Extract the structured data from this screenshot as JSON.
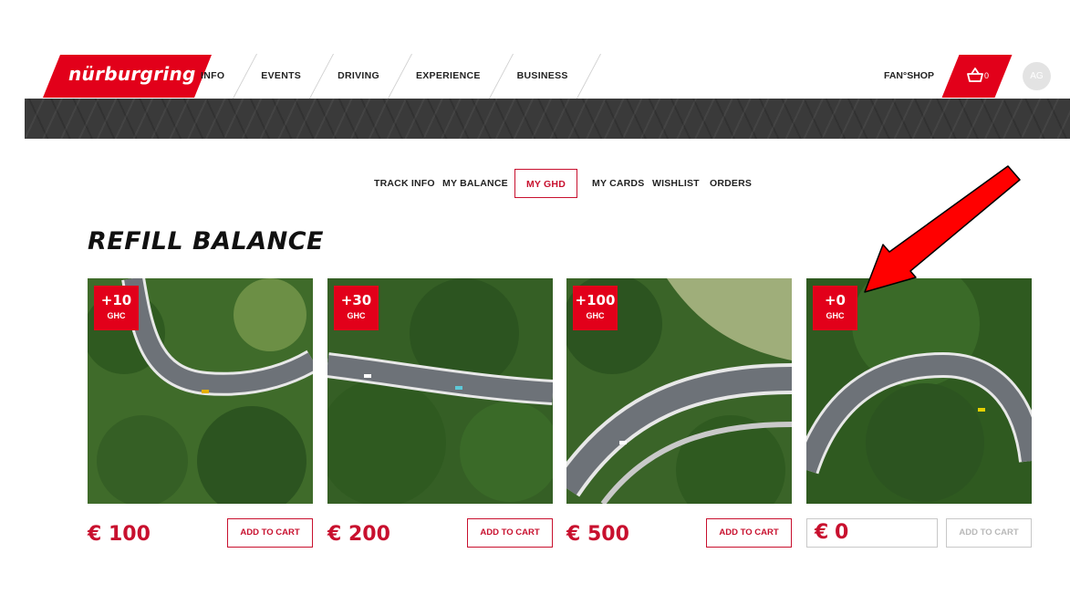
{
  "header": {
    "logo": "nürburgring",
    "nav": [
      "INFO",
      "EVENTS",
      "DRIVING",
      "EXPERIENCE",
      "BUSINESS"
    ],
    "fanshop": "FAN°SHOP",
    "cart_count": "0",
    "avatar_initials": "AG"
  },
  "subnav": {
    "items": [
      "TRACK INFO",
      "MY BALANCE",
      "MY GHD",
      "MY CARDS",
      "WISHLIST",
      "ORDERS"
    ],
    "active": "MY GHD"
  },
  "page": {
    "title": "REFILL BALANCE"
  },
  "cards": [
    {
      "amount": "+10",
      "unit": "GHC",
      "price": "€ 100",
      "button": "ADD TO CART"
    },
    {
      "amount": "+30",
      "unit": "GHC",
      "price": "€ 200",
      "button": "ADD TO CART"
    },
    {
      "amount": "+100",
      "unit": "GHC",
      "price": "€ 500",
      "button": "ADD TO CART"
    },
    {
      "amount": "+0",
      "unit": "GHC",
      "price_symbol": "€",
      "price_value": "0",
      "button": "ADD TO CART"
    }
  ],
  "colors": {
    "brand_red": "#e2001a",
    "dark_bar": "#3a3a3a",
    "annotation_arrow": "#ff0000"
  }
}
